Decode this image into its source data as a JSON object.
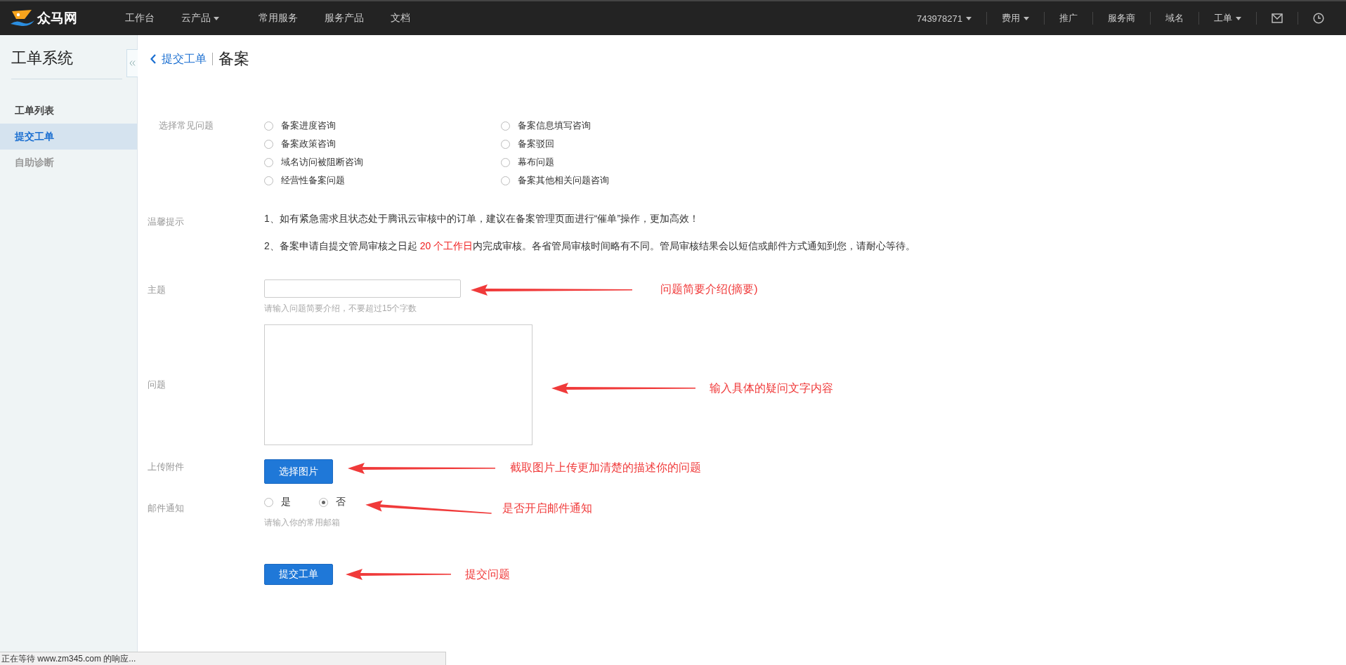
{
  "topbar": {
    "logo_text": "众马网",
    "nav": [
      {
        "label": "工作台",
        "dropdown": false
      },
      {
        "label": "云产品",
        "dropdown": true
      },
      {
        "label": "常用服务",
        "dropdown": false
      },
      {
        "label": "服务产品",
        "dropdown": false
      },
      {
        "label": "文档",
        "dropdown": false
      }
    ],
    "right_items": [
      {
        "label": "743978271",
        "dropdown": true
      },
      {
        "label": "费用",
        "dropdown": true
      },
      {
        "label": "推广",
        "dropdown": false
      },
      {
        "label": "服务商",
        "dropdown": false
      },
      {
        "label": "域名",
        "dropdown": false
      },
      {
        "label": "工单",
        "dropdown": true
      }
    ]
  },
  "sidebar": {
    "title": "工单系统",
    "items": [
      {
        "label": "工单列表",
        "selected": false,
        "disabled": false
      },
      {
        "label": "提交工单",
        "selected": true,
        "disabled": false
      },
      {
        "label": "自助诊断",
        "selected": false,
        "disabled": true
      }
    ]
  },
  "breadcrumb": {
    "back": "提交工单",
    "current": "备案"
  },
  "form": {
    "faq": {
      "label": "选择常见问题",
      "options": [
        {
          "label": "备案进度咨询",
          "selected": false
        },
        {
          "label": "备案信息填写咨询",
          "selected": false
        },
        {
          "label": "备案政策咨询",
          "selected": false
        },
        {
          "label": "备案驳回",
          "selected": false
        },
        {
          "label": "域名访问被阻断咨询",
          "selected": false
        },
        {
          "label": "幕布问题",
          "selected": false
        },
        {
          "label": "经营性备案问题",
          "selected": false
        },
        {
          "label": "备案其他相关问题咨询",
          "selected": false
        }
      ]
    },
    "tips": {
      "label": "温馨提示",
      "items": [
        {
          "before": "1、如有紧急需求且状态处于腾讯云审核中的订单，建议在备案管理页面进行“催单”操作，更加高效！"
        },
        {
          "before": "2、备案申请自提交管局审核之日起 ",
          "highlight": "20 个工作日",
          "after": "内完成审核。各省管局审核时间略有不同。管局审核结果会以短信或邮件方式通知到您，请耐心等待。"
        }
      ]
    },
    "subject": {
      "label": "主题",
      "hint": "请输入问题简要介绍，不要超过15个字数",
      "annotation": "问题简要介绍(摘要)"
    },
    "question": {
      "label": "问题",
      "annotation": "输入具体的疑问文字内容"
    },
    "attachment": {
      "label": "上传附件",
      "button": "选择图片",
      "annotation": "截取图片上传更加清楚的描述你的问题"
    },
    "email_notify": {
      "label": "邮件通知",
      "options": [
        {
          "label": "是",
          "selected": false
        },
        {
          "label": "否",
          "selected": true
        }
      ],
      "hint": "请输入你的常用邮箱",
      "annotation": "是否开启邮件通知"
    },
    "submit": {
      "button": "提交工单",
      "annotation": "提交问题"
    }
  },
  "status_bar": "正在等待 www.zm345.com 的响应..."
}
